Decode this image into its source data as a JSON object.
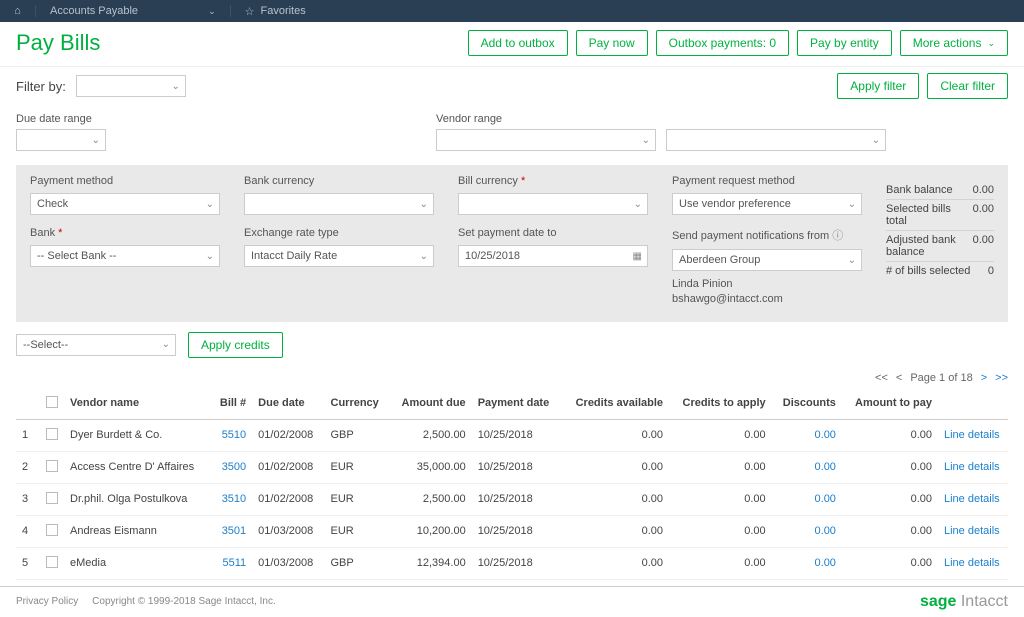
{
  "nav": {
    "module": "Accounts Payable",
    "favorites": "Favorites"
  },
  "page": {
    "title": "Pay Bills"
  },
  "buttons": {
    "add_to_outbox": "Add to outbox",
    "pay_now": "Pay now",
    "outbox_payments": "Outbox payments: 0",
    "pay_by_entity": "Pay by entity",
    "more_actions": "More actions",
    "apply_filter": "Apply filter",
    "clear_filter": "Clear filter",
    "apply_credits": "Apply credits"
  },
  "filter": {
    "label": "Filter by:",
    "select_placeholder": "--Select--"
  },
  "ranges": {
    "due_date": "Due date range",
    "vendor": "Vendor range"
  },
  "payment": {
    "method_label": "Payment method",
    "method_value": "Check",
    "bank_label": "Bank",
    "bank_value": "-- Select Bank --",
    "bank_currency_label": "Bank currency",
    "bank_currency_value": "",
    "exchange_label": "Exchange rate type",
    "exchange_value": "Intacct Daily Rate",
    "bill_currency_label": "Bill currency",
    "bill_currency_value": "",
    "set_date_label": "Set payment date to",
    "set_date_value": "10/25/2018",
    "request_method_label": "Payment request method",
    "request_method_value": "Use vendor preference",
    "notif_label": "Send payment notifications from",
    "notif_value": "Aberdeen Group",
    "notif_person": "Linda Pinion",
    "notif_email": "bshawgo@intacct.com"
  },
  "summary": {
    "bank_balance_label": "Bank balance",
    "bank_balance": "0.00",
    "selected_total_label": "Selected bills total",
    "selected_total": "0.00",
    "adjusted_label": "Adjusted bank balance",
    "adjusted": "0.00",
    "count_label": "# of bills selected",
    "count": "0"
  },
  "pager": {
    "text": "Page 1 of 18"
  },
  "table": {
    "cols": {
      "vendor": "Vendor name",
      "bill": "Bill #",
      "due": "Due date",
      "currency": "Currency",
      "amount_due": "Amount due",
      "payment_date": "Payment date",
      "credits_avail": "Credits available",
      "credits_apply": "Credits to apply",
      "discounts": "Discounts",
      "amount_pay": "Amount to pay"
    },
    "line_details": "Line details",
    "rows": [
      {
        "n": "1",
        "vendor": "Dyer Burdett & Co.",
        "bill": "5510",
        "due": "01/02/2008",
        "currency": "GBP",
        "amount_due": "2,500.00",
        "payment_date": "10/25/2018",
        "credits_avail": "0.00",
        "credits_apply": "0.00",
        "discounts": "0.00",
        "amount_pay": "0.00"
      },
      {
        "n": "2",
        "vendor": "Access Centre D' Affaires",
        "bill": "3500",
        "due": "01/02/2008",
        "currency": "EUR",
        "amount_due": "35,000.00",
        "payment_date": "10/25/2018",
        "credits_avail": "0.00",
        "credits_apply": "0.00",
        "discounts": "0.00",
        "amount_pay": "0.00"
      },
      {
        "n": "3",
        "vendor": "Dr.phil. Olga Postulkova",
        "bill": "3510",
        "due": "01/02/2008",
        "currency": "EUR",
        "amount_due": "2,500.00",
        "payment_date": "10/25/2018",
        "credits_avail": "0.00",
        "credits_apply": "0.00",
        "discounts": "0.00",
        "amount_pay": "0.00"
      },
      {
        "n": "4",
        "vendor": "Andreas Eismann",
        "bill": "3501",
        "due": "01/03/2008",
        "currency": "EUR",
        "amount_due": "10,200.00",
        "payment_date": "10/25/2018",
        "credits_avail": "0.00",
        "credits_apply": "0.00",
        "discounts": "0.00",
        "amount_pay": "0.00"
      },
      {
        "n": "5",
        "vendor": "eMedia",
        "bill": "5511",
        "due": "01/03/2008",
        "currency": "GBP",
        "amount_due": "12,394.00",
        "payment_date": "10/25/2018",
        "credits_avail": "0.00",
        "credits_apply": "0.00",
        "discounts": "0.00",
        "amount_pay": "0.00"
      }
    ]
  },
  "footer": {
    "privacy": "Privacy Policy",
    "copyright": "Copyright © 1999-2018 Sage Intacct, Inc.",
    "logo_sage": "sage",
    "logo_intacct": "Intacct"
  }
}
